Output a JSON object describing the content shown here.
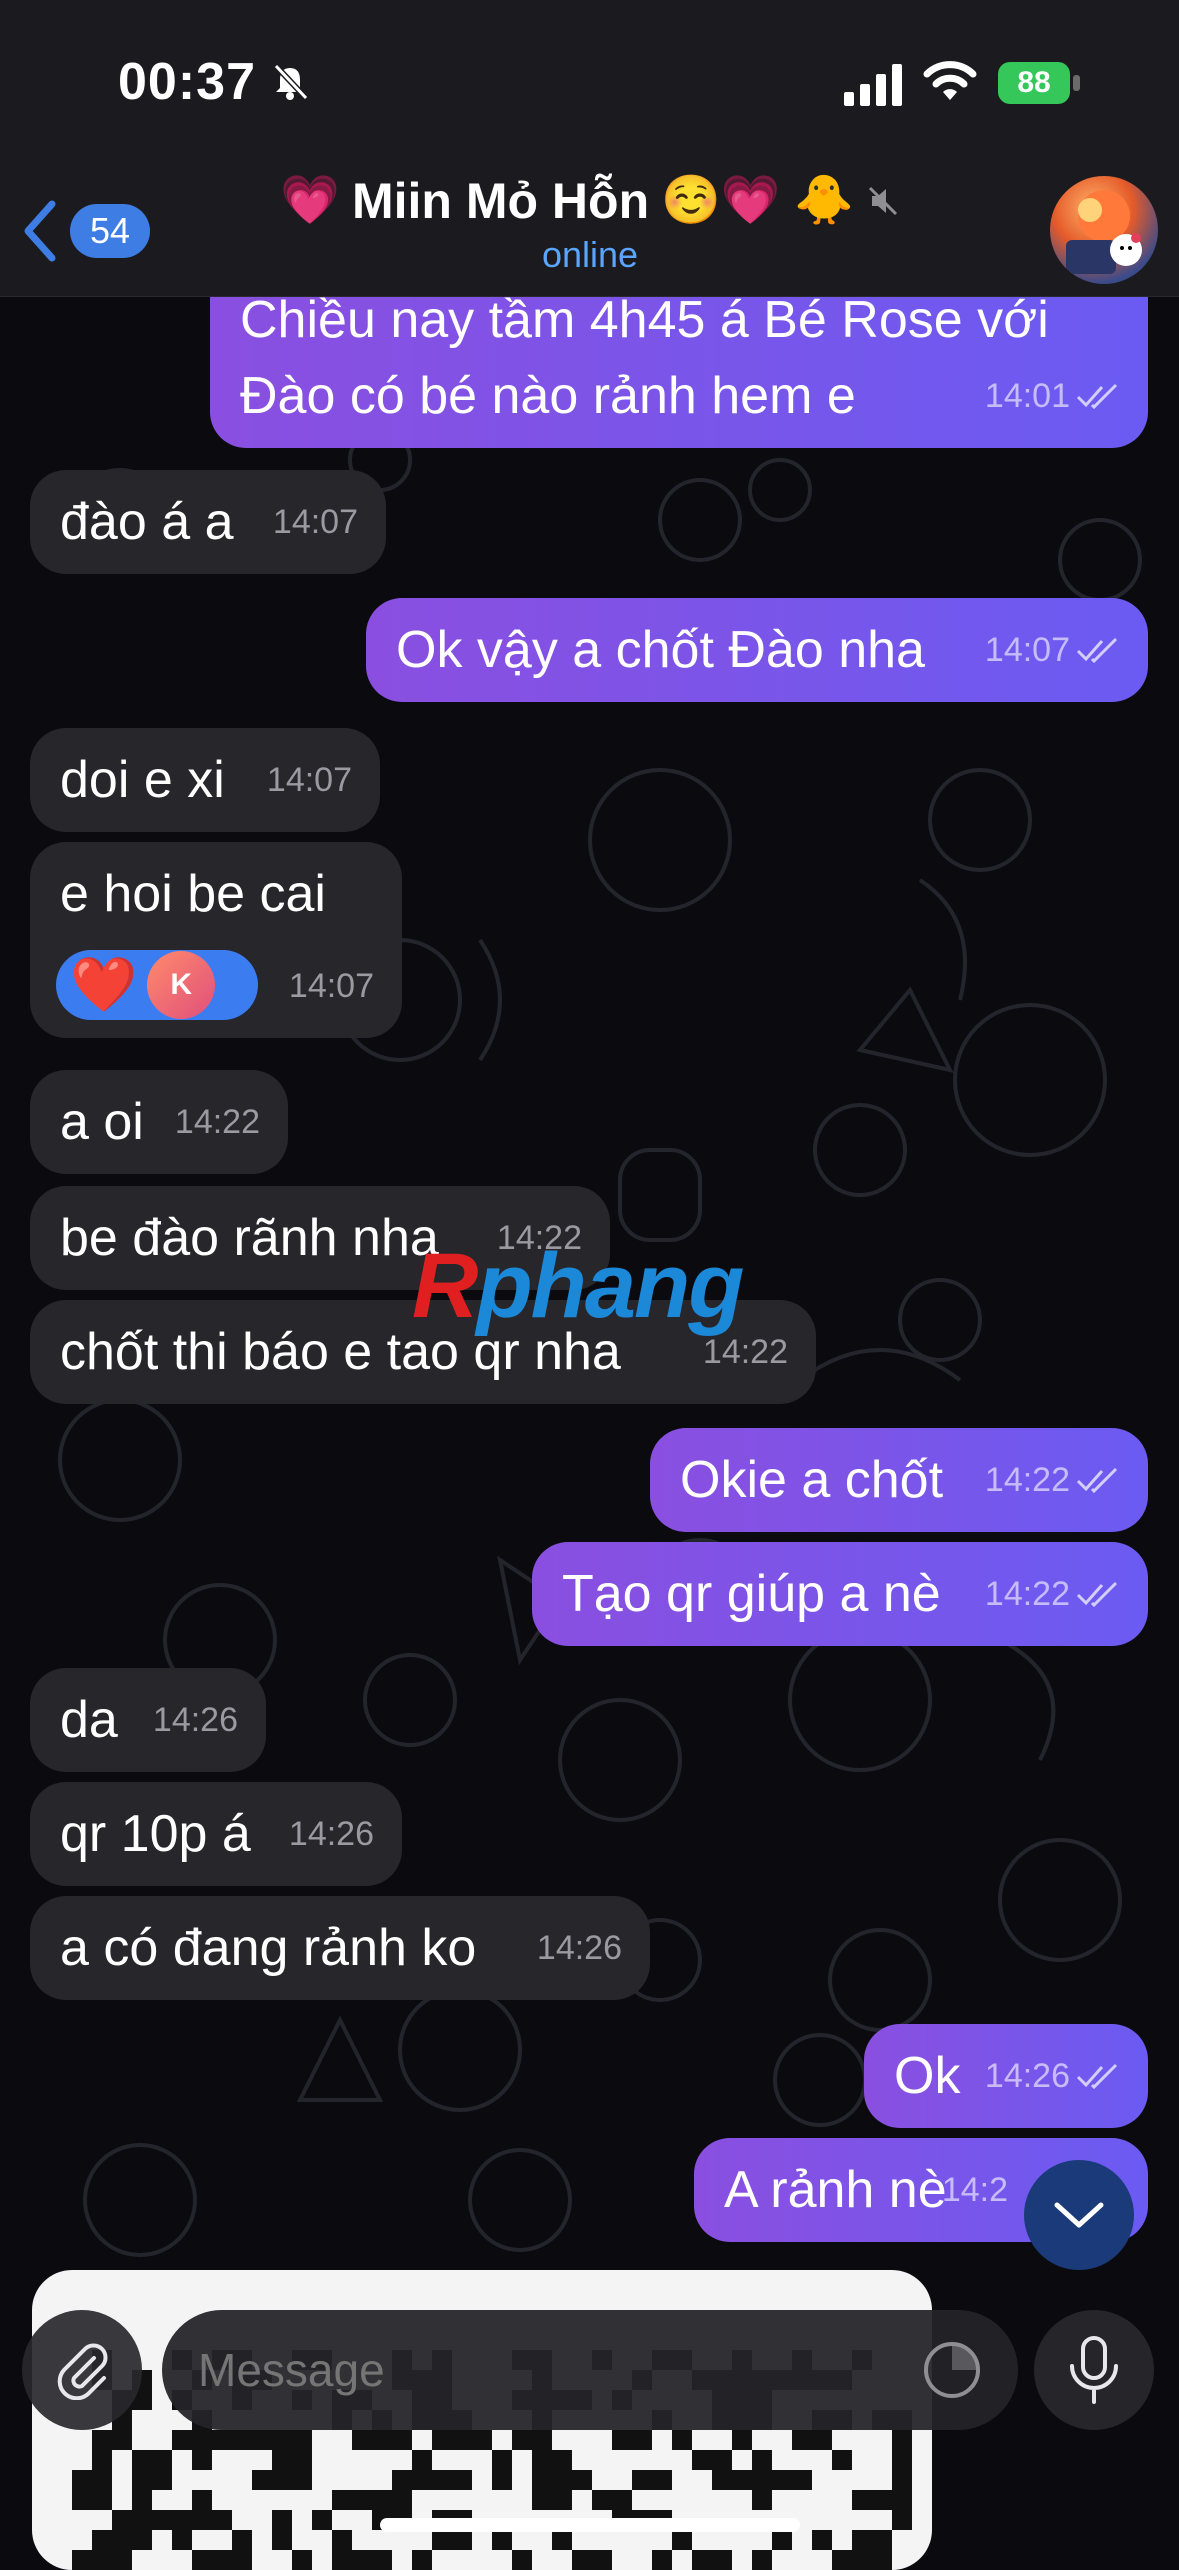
{
  "status_bar": {
    "time": "00:37",
    "battery": "88"
  },
  "header": {
    "back_count": "54",
    "title_lead_emoji": "💗",
    "title": "Miin Mỏ Hỗn",
    "title_emojis": "☺️💗 🐥",
    "status": "online"
  },
  "messages": [
    {
      "dir": "out",
      "text": "Chiều nay tầm 4h45 á Bé Rose với",
      "text2": "Đào có bé nào rảnh hem e",
      "time": "14:01",
      "read": true
    },
    {
      "dir": "in",
      "text": "đào á a",
      "time": "14:07"
    },
    {
      "dir": "out",
      "text": "Ok vậy a chốt Đào nha",
      "time": "14:07",
      "read": true
    },
    {
      "dir": "in",
      "text": "doi e xi",
      "time": "14:07"
    },
    {
      "dir": "in",
      "text": "e hoi be cai",
      "time": "14:07",
      "reaction": {
        "emoji": "❤️",
        "avatar_letter": "K"
      }
    },
    {
      "dir": "in",
      "text": "a oi",
      "time": "14:22"
    },
    {
      "dir": "in",
      "text": "be đào rãnh nha",
      "time": "14:22"
    },
    {
      "dir": "in",
      "text": "chốt thi báo e tao qr nha",
      "time": "14:22"
    },
    {
      "dir": "out",
      "text": "Okie a chốt",
      "time": "14:22",
      "read": true
    },
    {
      "dir": "out",
      "text": "Tạo qr giúp a nè",
      "time": "14:22",
      "read": true
    },
    {
      "dir": "in",
      "text": "da",
      "time": "14:26"
    },
    {
      "dir": "in",
      "text": "qr 10p á",
      "time": "14:26"
    },
    {
      "dir": "in",
      "text": "a có đang rảnh ko",
      "time": "14:26"
    },
    {
      "dir": "out",
      "text": "Ok",
      "time": "14:26",
      "read": true
    },
    {
      "dir": "out",
      "text": "A rảnh nè",
      "time": "14:2"
    }
  ],
  "watermark": {
    "first": "R",
    "rest": "phang"
  },
  "composer": {
    "placeholder": "Message"
  },
  "colors": {
    "accent": "#3e7de4",
    "outgoing": "#7b55ea",
    "incoming": "#26262b",
    "online": "#5aa5ff"
  }
}
